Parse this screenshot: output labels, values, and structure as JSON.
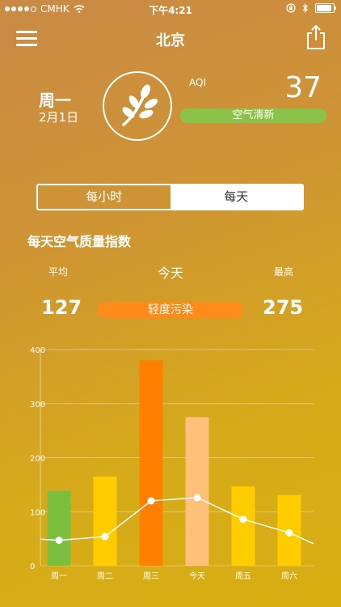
{
  "status_bar": {
    "carrier": "CMHK",
    "time": "下午4:21",
    "signal_dots_filled": 4,
    "signal_dots_total": 5,
    "battery_level": 0.9
  },
  "header": {
    "title": "北京",
    "menu_icon": "hamburger-menu-icon",
    "share_icon": "share-icon"
  },
  "summary": {
    "day": "周一",
    "date": "2月1日",
    "emblem_icon": "leaf-icon",
    "aqi_label": "AQI",
    "aqi_value": "37",
    "aqi_status": "空气清新",
    "aqi_status_color": "#8bc34a"
  },
  "tabs": [
    {
      "label": "每小时",
      "active": false
    },
    {
      "label": "每天",
      "active": true
    }
  ],
  "daily": {
    "section_title": "每天空气质量指数",
    "avg_label": "平均",
    "avg_value": "127",
    "today_label": "今天",
    "today_status": "轻度污染",
    "today_status_color": "#ff8c1a",
    "max_label": "最高",
    "max_value": "275"
  },
  "chart_data": {
    "type": "bar",
    "categories": [
      "周一",
      "周二",
      "周三",
      "今天",
      "周五",
      "周六"
    ],
    "series": [
      {
        "values": [
          139,
          165,
          380,
          275,
          147,
          131
        ],
        "colors": [
          "#7cbf3f",
          "#ffcc00",
          "#ff8000",
          "#ffc07a",
          "#ffcc00",
          "#ffcc00"
        ]
      },
      {
        "type": "line",
        "values": [
          47,
          54,
          120,
          126,
          86,
          61
        ],
        "color": "#ffffff"
      }
    ],
    "yticks": [
      0,
      100,
      200,
      300,
      400
    ],
    "ylim": [
      0,
      400
    ],
    "grid": true
  }
}
